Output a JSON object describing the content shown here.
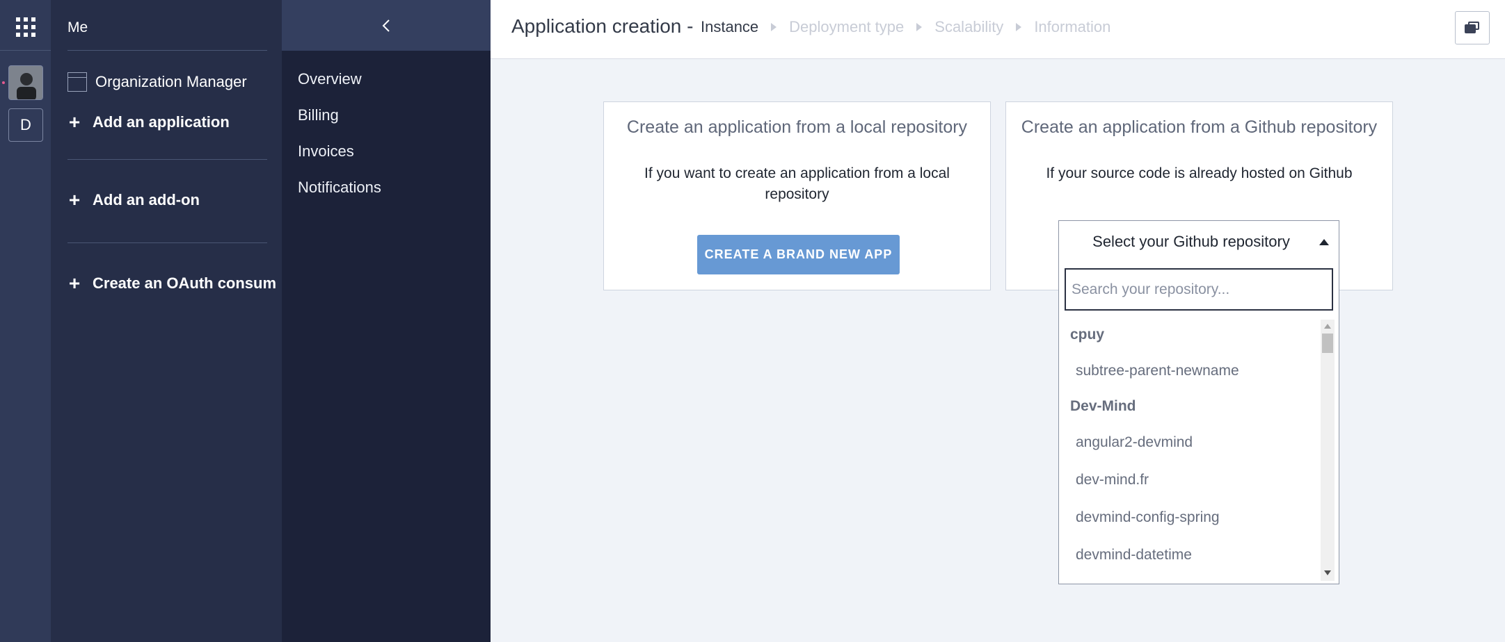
{
  "rail": {
    "org_initial": "D",
    "icons": {
      "apps": "apps-grid-icon",
      "avatar": "user-avatar"
    }
  },
  "org_panel": {
    "title": "Me",
    "org_manager": "Organization Manager",
    "add_application": "Add an application",
    "add_addon": "Add an add-on",
    "create_oauth": "Create an OAuth consum"
  },
  "subnav": {
    "collapse_icon": "chevron-left-icon",
    "items": [
      "Overview",
      "Billing",
      "Invoices",
      "Notifications"
    ]
  },
  "header": {
    "title": "Application creation -",
    "steps": [
      "Instance",
      "Deployment type",
      "Scalability",
      "Information"
    ],
    "active_step": "Instance",
    "chat_icon": "chat-icon"
  },
  "local_card": {
    "title": "Create an application from a local repository",
    "description": "If you want to create an application from a local repository",
    "button": "CREATE A BRAND NEW APP"
  },
  "github_card": {
    "title": "Create an application from a Github repository",
    "description": "If your source code is already hosted on Github"
  },
  "repo_select": {
    "label": "Select your Github repository",
    "search_placeholder": "Search your repository...",
    "groups": [
      {
        "name": "cpuy",
        "repos": [
          "subtree-parent-newname"
        ]
      },
      {
        "name": "Dev-Mind",
        "repos": [
          "angular2-devmind",
          "dev-mind.fr",
          "devmind-config-spring",
          "devmind-datetime"
        ]
      }
    ]
  },
  "colors": {
    "rail": "#303a58",
    "org_panel": "#262e48",
    "subnav": "#1c2239",
    "primary_button": "#6799d4"
  }
}
